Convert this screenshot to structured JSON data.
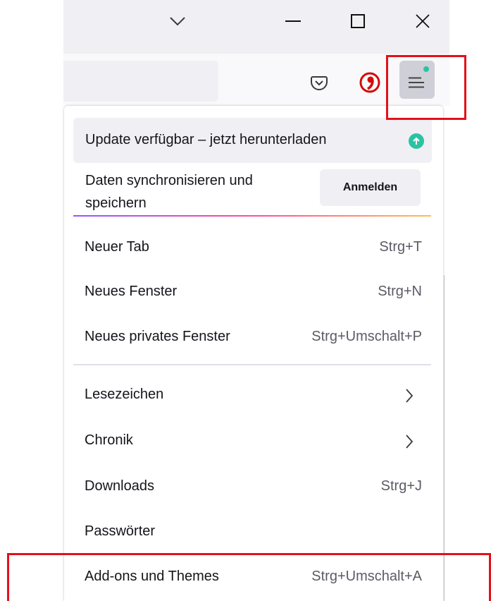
{
  "titlebar": {
    "controls": [
      {
        "name": "tab-list-chevron",
        "icon": "chevron-down-icon"
      },
      {
        "name": "minimize",
        "icon": "minimize-icon"
      },
      {
        "name": "maximize",
        "icon": "maximize-icon"
      },
      {
        "name": "close",
        "icon": "close-icon"
      }
    ]
  },
  "toolbar": {
    "icons": [
      "pocket-icon",
      "extension-icon",
      "hamburger-menu-icon"
    ],
    "menu_badge_color": "#2ac3a2",
    "highlight_color": "#e4101a"
  },
  "menu": {
    "update_label": "Update verfügbar – jetzt herunterladen",
    "sync_label": "Daten synchronisieren und speichern",
    "signin_button": "Anmelden",
    "items": [
      {
        "label": "Neuer Tab",
        "shortcut": "Strg+T"
      },
      {
        "label": "Neues Fenster",
        "shortcut": "Strg+N"
      },
      {
        "label": "Neues privates Fenster",
        "shortcut": "Strg+Umschalt+P"
      },
      {
        "label": "Lesezeichen",
        "shortcut": ""
      },
      {
        "label": "Chronik",
        "shortcut": ""
      },
      {
        "label": "Downloads",
        "shortcut": "Strg+J"
      },
      {
        "label": "Passwörter",
        "shortcut": ""
      },
      {
        "label": "Add-ons und Themes",
        "shortcut": "Strg+Umschalt+A"
      }
    ]
  }
}
